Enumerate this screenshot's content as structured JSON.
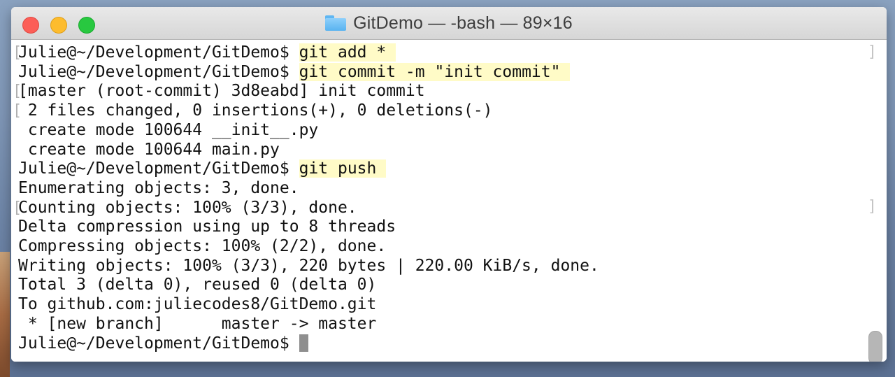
{
  "window": {
    "title": "GitDemo — -bash — 89×16",
    "folder_icon": "folder-icon"
  },
  "traffic_lights": {
    "close": "#fc5e57",
    "minimize": "#fdbc2e",
    "maximize": "#28c840"
  },
  "colors": {
    "command_highlight": "#fffbc7",
    "text": "#111111",
    "cursor": "#8f8f8f"
  },
  "terminal": {
    "lines": [
      {
        "prompt": "Julie@~/Development/GitDemo$ ",
        "cmd": "git add * "
      },
      {
        "prompt": "Julie@~/Development/GitDemo$ ",
        "cmd": "git commit -m \"init commit\" "
      },
      {
        "text": "[master (root-commit) 3d8eabd] init commit"
      },
      {
        "text": " 2 files changed, 0 insertions(+), 0 deletions(-)"
      },
      {
        "text": " create mode 100644 __init__.py"
      },
      {
        "text": " create mode 100644 main.py"
      },
      {
        "prompt": "Julie@~/Development/GitDemo$ ",
        "cmd": "git push "
      },
      {
        "text": "Enumerating objects: 3, done."
      },
      {
        "text": "Counting objects: 100% (3/3), done."
      },
      {
        "text": "Delta compression using up to 8 threads"
      },
      {
        "text": "Compressing objects: 100% (2/2), done."
      },
      {
        "text": "Writing objects: 100% (3/3), 220 bytes | 220.00 KiB/s, done."
      },
      {
        "text": "Total 3 (delta 0), reused 0 (delta 0)"
      },
      {
        "text": "To github.com:juliecodes8/GitDemo.git"
      },
      {
        "text": " * [new branch]      master -> master"
      },
      {
        "prompt": "Julie@~/Development/GitDemo$ ",
        "cmd": ""
      }
    ]
  }
}
